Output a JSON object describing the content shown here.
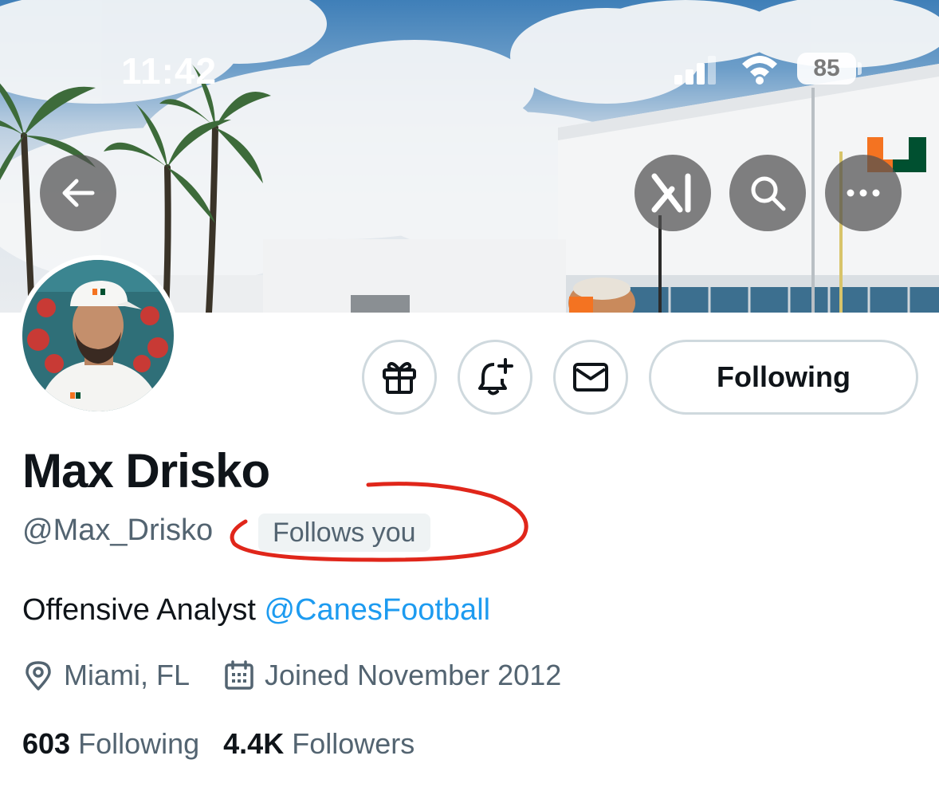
{
  "status_bar": {
    "time": "11:42",
    "battery": "85"
  },
  "banner": {
    "description_icon": "stadium-banner-image",
    "logo_letter": "U",
    "accent_orange": "#f47321",
    "accent_green": "#005030"
  },
  "nav": {
    "back_icon": "arrow-left-icon",
    "grok_icon": "grok-icon",
    "search_icon": "search-icon",
    "more_icon": "more-icon"
  },
  "actions": {
    "gift_icon": "gift-icon",
    "notify_icon": "bell-plus-icon",
    "message_icon": "envelope-icon",
    "following_label": "Following"
  },
  "profile": {
    "name": "Max Drisko",
    "handle": "@Max_Drisko",
    "follows_badge": "Follows you",
    "bio_text": "Offensive Analyst ",
    "bio_link": "@CanesFootball",
    "location": "Miami, FL",
    "joined": "Joined November 2012",
    "following_count": "603",
    "following_label": "Following",
    "followers_count": "4.4K",
    "followers_label": "Followers"
  },
  "colors": {
    "link_blue": "#1d9bf0",
    "secondary_text": "#536471",
    "annotation_red": "#e0261a"
  }
}
